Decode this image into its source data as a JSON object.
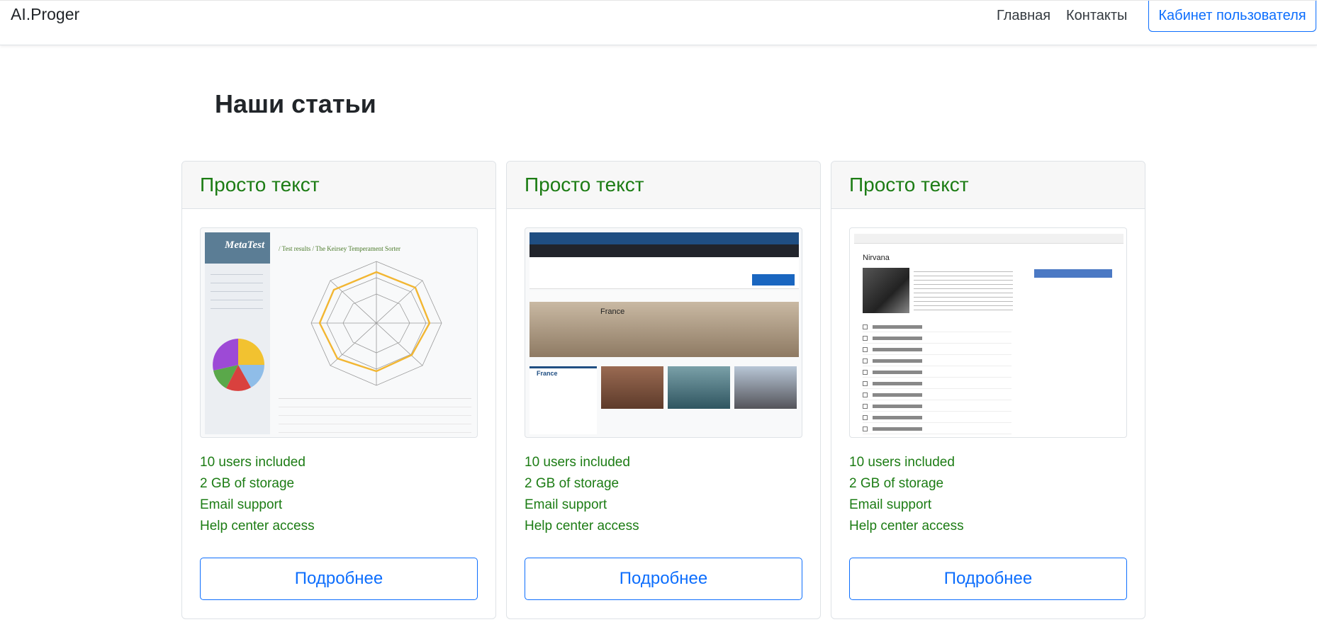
{
  "navbar": {
    "brand": "AI.Proger",
    "links": [
      "Главная",
      "Контакты"
    ],
    "cabinet_button": "Кабинет пользователя"
  },
  "page": {
    "title": "Наши статьи"
  },
  "cards": [
    {
      "title": "Просто текст",
      "features": [
        "10 users included",
        "2 GB of storage",
        "Email support",
        "Help center access"
      ],
      "button": "Подробнее"
    },
    {
      "title": "Просто текст",
      "features": [
        "10 users included",
        "2 GB of storage",
        "Email support",
        "Help center access"
      ],
      "button": "Подробнее"
    },
    {
      "title": "Просто текст",
      "features": [
        "10 users included",
        "2 GB of storage",
        "Email support",
        "Help center access"
      ],
      "button": "Подробнее"
    }
  ],
  "thumbnails": {
    "metatest": {
      "logo": "MetaTest",
      "heading": "/ Test results / The Keirsey Temperament Sorter"
    },
    "tagfly": {
      "hero_label": "France",
      "filter_title": "France"
    },
    "nirvana": {
      "artist": "Nirvana"
    }
  },
  "colors": {
    "accent_blue": "#0d6efd",
    "feature_green": "#1c7c14",
    "header_bg": "#f7f7f7"
  }
}
